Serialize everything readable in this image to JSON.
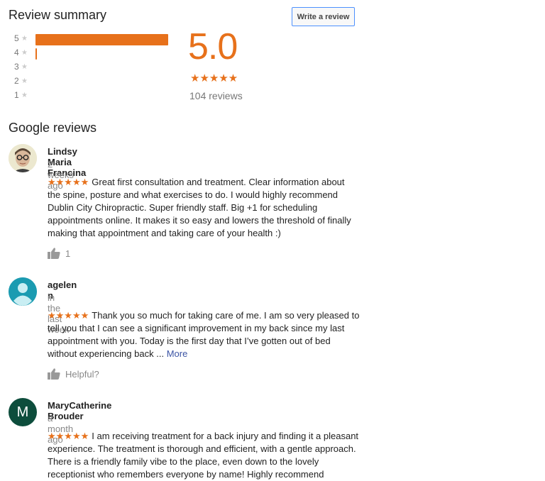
{
  "summary": {
    "title": "Review summary",
    "write_review_label": "Write a review",
    "distribution": [
      {
        "stars": "5",
        "fraction": 1.0
      },
      {
        "stars": "4",
        "fraction": 0.01
      },
      {
        "stars": "3",
        "fraction": 0.0
      },
      {
        "stars": "2",
        "fraction": 0.0
      },
      {
        "stars": "1",
        "fraction": 0.0
      }
    ],
    "rating": "5.0",
    "rating_stars": "★★★★★",
    "review_count": "104 reviews",
    "accent_color": "#e7711b"
  },
  "reviews_section": {
    "title": "Google reviews",
    "reviews": [
      {
        "name": "Lindsy Maria Francina",
        "date": "2 weeks ago",
        "stars": "★★★★★",
        "text": "Great first consultation and treatment. Clear information about the spine, posture and what exercises to do. I would highly recommend Dublin City Chiropractic. Super friendly staff. Big +1 for scheduling appointments online. It makes it so easy and lowers the threshold of finally making that appointment and taking care of your health :)",
        "likes": "1",
        "avatar": "photo"
      },
      {
        "name": "agelen n",
        "date": "in the last week",
        "stars": "★★★★★",
        "text": "Thank you so much for taking care of me. I am so very pleased to tell you that I can see a significant improvement in my back since my last appointment with you. Today is the first day that I’ve gotten out of bed without experiencing back",
        "ellipsis": "...",
        "more": "More",
        "likes": "Helpful?",
        "avatar": "default-person-icon",
        "avatar_color": "#1b9bb1"
      },
      {
        "name": "MaryCatherine Brouder",
        "date": "a month ago",
        "stars": "★★★★★",
        "text": "I am receiving treatment for a back injury and finding it a pleasant experience. The treatment is thorough and efficient, with a gentle approach. There is a friendly family vibe to the place, even down to the lovely receptionist who remembers everyone by name! Highly recommend",
        "avatar_letter": "M",
        "avatar_color": "#0d4d3c"
      }
    ]
  }
}
